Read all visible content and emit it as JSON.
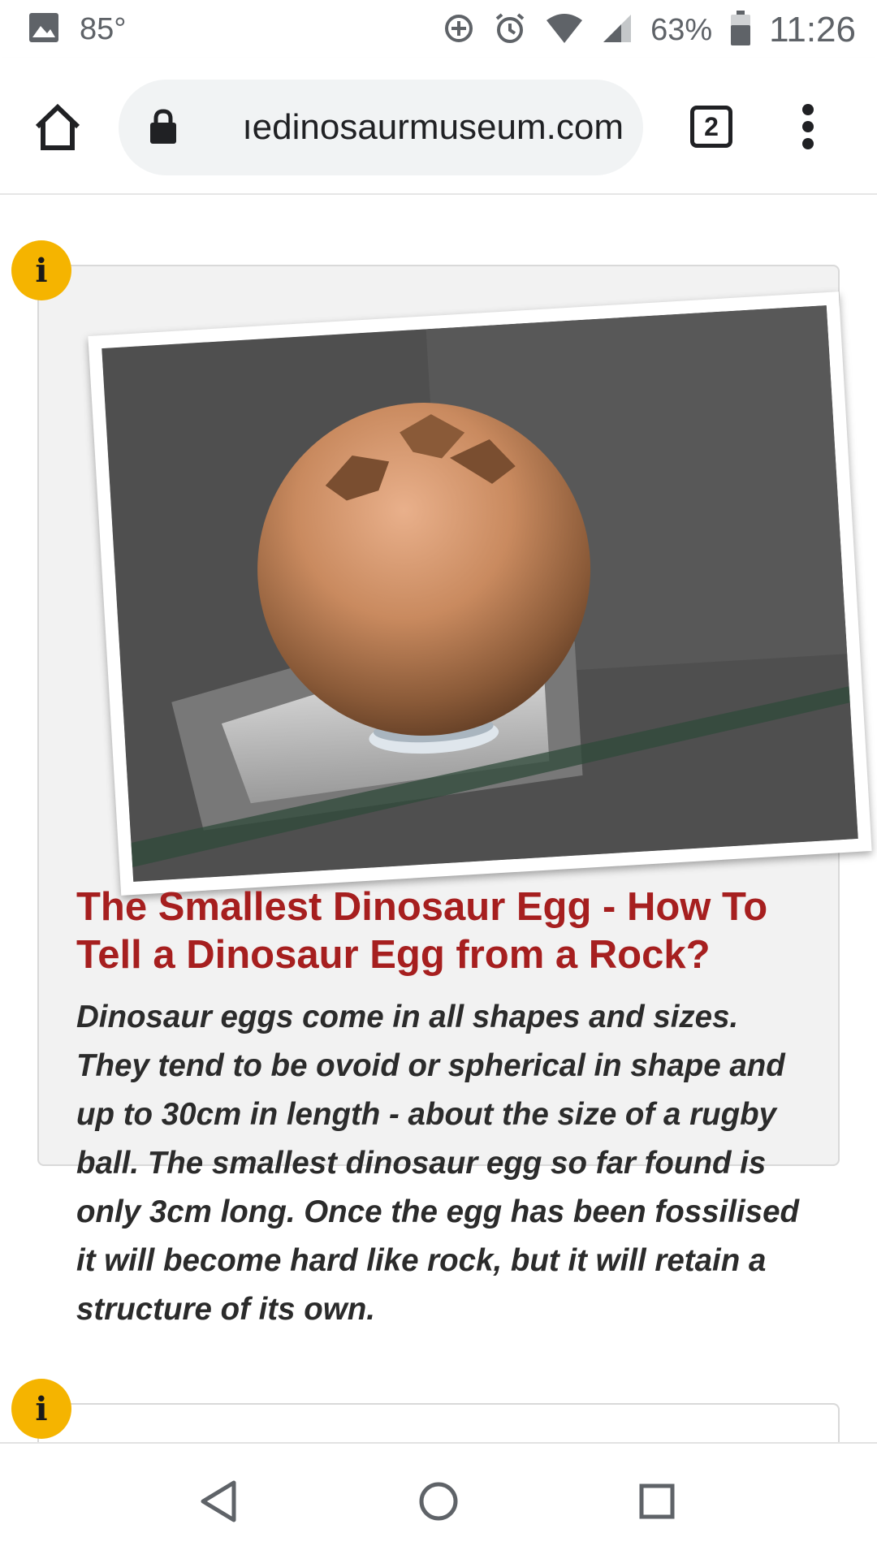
{
  "status_bar": {
    "temperature": "85°",
    "battery": "63%",
    "time": "11:26",
    "icons": [
      "gallery-icon",
      "data-saver-icon",
      "alarm-icon",
      "wifi-icon",
      "cell-signal-icon",
      "battery-icon"
    ]
  },
  "browser": {
    "url": "ıedinosaurmuseum.com",
    "tab_count": "2"
  },
  "article": {
    "info_badge": "i",
    "title": "The Smallest Dinosaur Egg - How To Tell a Dinosaur Egg from a Rock?",
    "body": "Dinosaur eggs come in all shapes and sizes. They tend to be ovoid or spherical in shape and up to 30cm in length - about the size of a rugby ball. The smallest dinosaur egg so far found is only 3cm long. Once the egg has been fossilised it will become hard like rock, but it will retain a structure of its own."
  },
  "next_card": {
    "info_badge": "i"
  },
  "colors": {
    "title_red": "#a61f1f",
    "badge_yellow": "#f5b400",
    "card_bg": "#f2f2f2"
  }
}
